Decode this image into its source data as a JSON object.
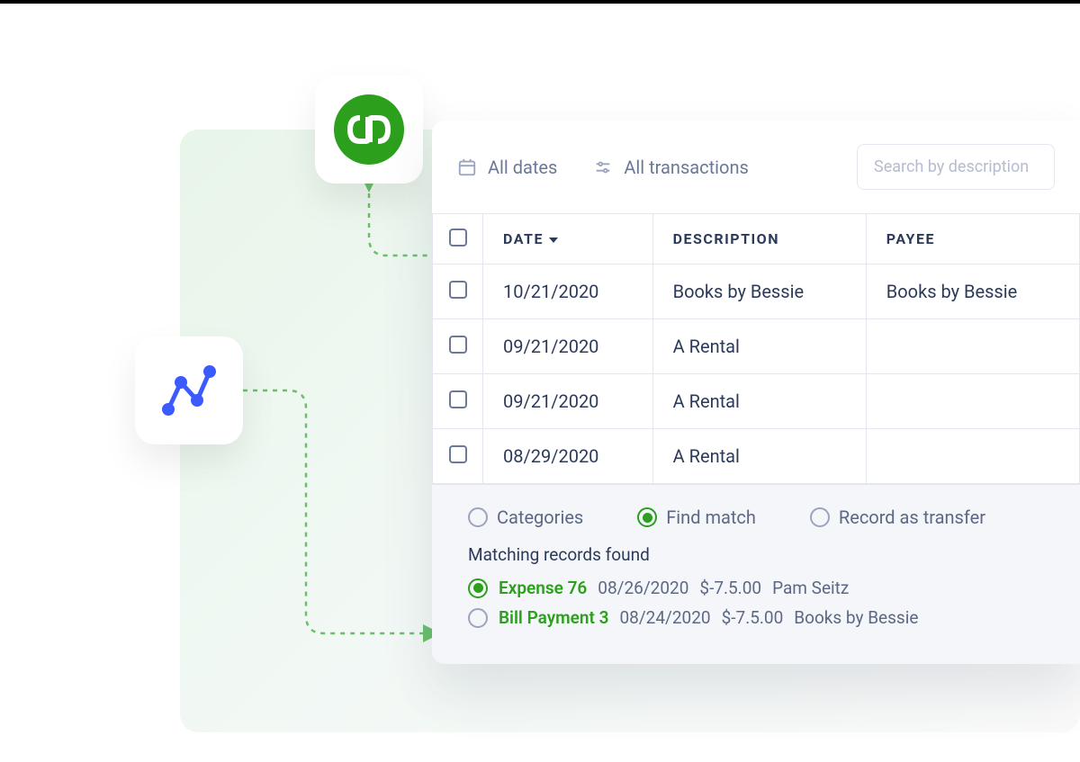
{
  "toolbar": {
    "dates_label": "All dates",
    "transactions_label": "All transactions",
    "search_placeholder": "Search by description"
  },
  "columns": {
    "date": "DATE",
    "description": "DESCRIPTION",
    "payee": "PAYEE"
  },
  "rows": [
    {
      "date": "10/21/2020",
      "description": "Books by Bessie",
      "payee": "Books by Bessie"
    },
    {
      "date": "09/21/2020",
      "description": "A Rental",
      "payee": ""
    },
    {
      "date": "09/21/2020",
      "description": "A Rental",
      "payee": ""
    },
    {
      "date": "08/29/2020",
      "description": "A Rental",
      "payee": ""
    }
  ],
  "match_tabs": {
    "categories": "Categories",
    "find_match": "Find match",
    "record_transfer": "Record as transfer",
    "selected": "find_match"
  },
  "matching": {
    "heading": "Matching records found",
    "records": [
      {
        "type": "Expense 76",
        "date": "08/26/2020",
        "amount": "$-7.5.00",
        "party": "Pam Seitz",
        "selected": true
      },
      {
        "type": "Bill Payment 3",
        "date": "08/24/2020",
        "amount": "$-7.5.00",
        "party": "Books by Bessie",
        "selected": false
      }
    ]
  },
  "icons": {
    "qb": "qb",
    "nodes": "nodes-graph"
  }
}
